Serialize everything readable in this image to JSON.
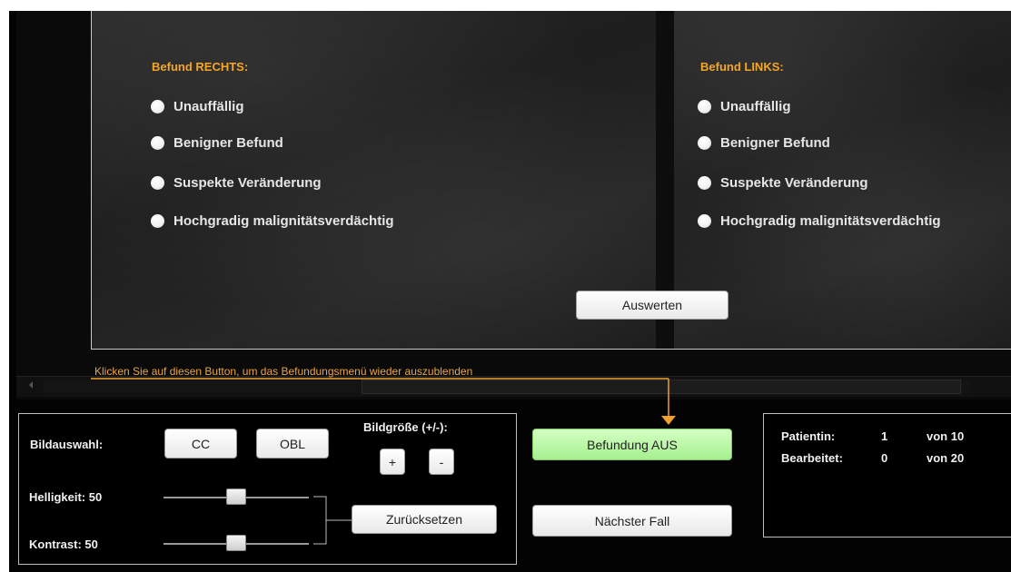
{
  "befund_rechts": {
    "title": "Befund RECHTS:",
    "options": [
      "Unauffällig",
      "Benigner Befund",
      "Suspekte Veränderung",
      "Hochgradig malignitätsverdächtig"
    ]
  },
  "befund_links": {
    "title": "Befund LINKS:",
    "options": [
      "Unauffällig",
      "Benigner Befund",
      "Suspekte Veränderung",
      "Hochgradig malignitätsverdächtig"
    ]
  },
  "auswerten_label": "Auswerten",
  "hint_text": "Klicken Sie auf diesen Button, um das Befundungsmenü wieder auszublenden",
  "controls": {
    "bildauswahl_label": "Bildauswahl:",
    "cc_label": "CC",
    "obl_label": "OBL",
    "bildgroesse_label": "Bildgröße (+/-):",
    "plus_label": "+",
    "minus_label": "-",
    "helligkeit_label": "Helligkeit: 50",
    "kontrast_label": "Kontrast: 50",
    "helligkeit_value": 50,
    "kontrast_value": 50,
    "reset_label": "Zurücksetzen"
  },
  "befundung_aus_label": "Befundung AUS",
  "naechster_fall_label": "Nächster Fall",
  "status": {
    "patientin_label": "Patientin:",
    "patientin_value": "1",
    "patientin_total": "von 10",
    "bearbeitet_label": "Bearbeitet:",
    "bearbeitet_value": "0",
    "bearbeitet_total": "von 20"
  },
  "colors": {
    "accent_orange": "#f5a623",
    "active_button_green": "#b8f5a0"
  }
}
